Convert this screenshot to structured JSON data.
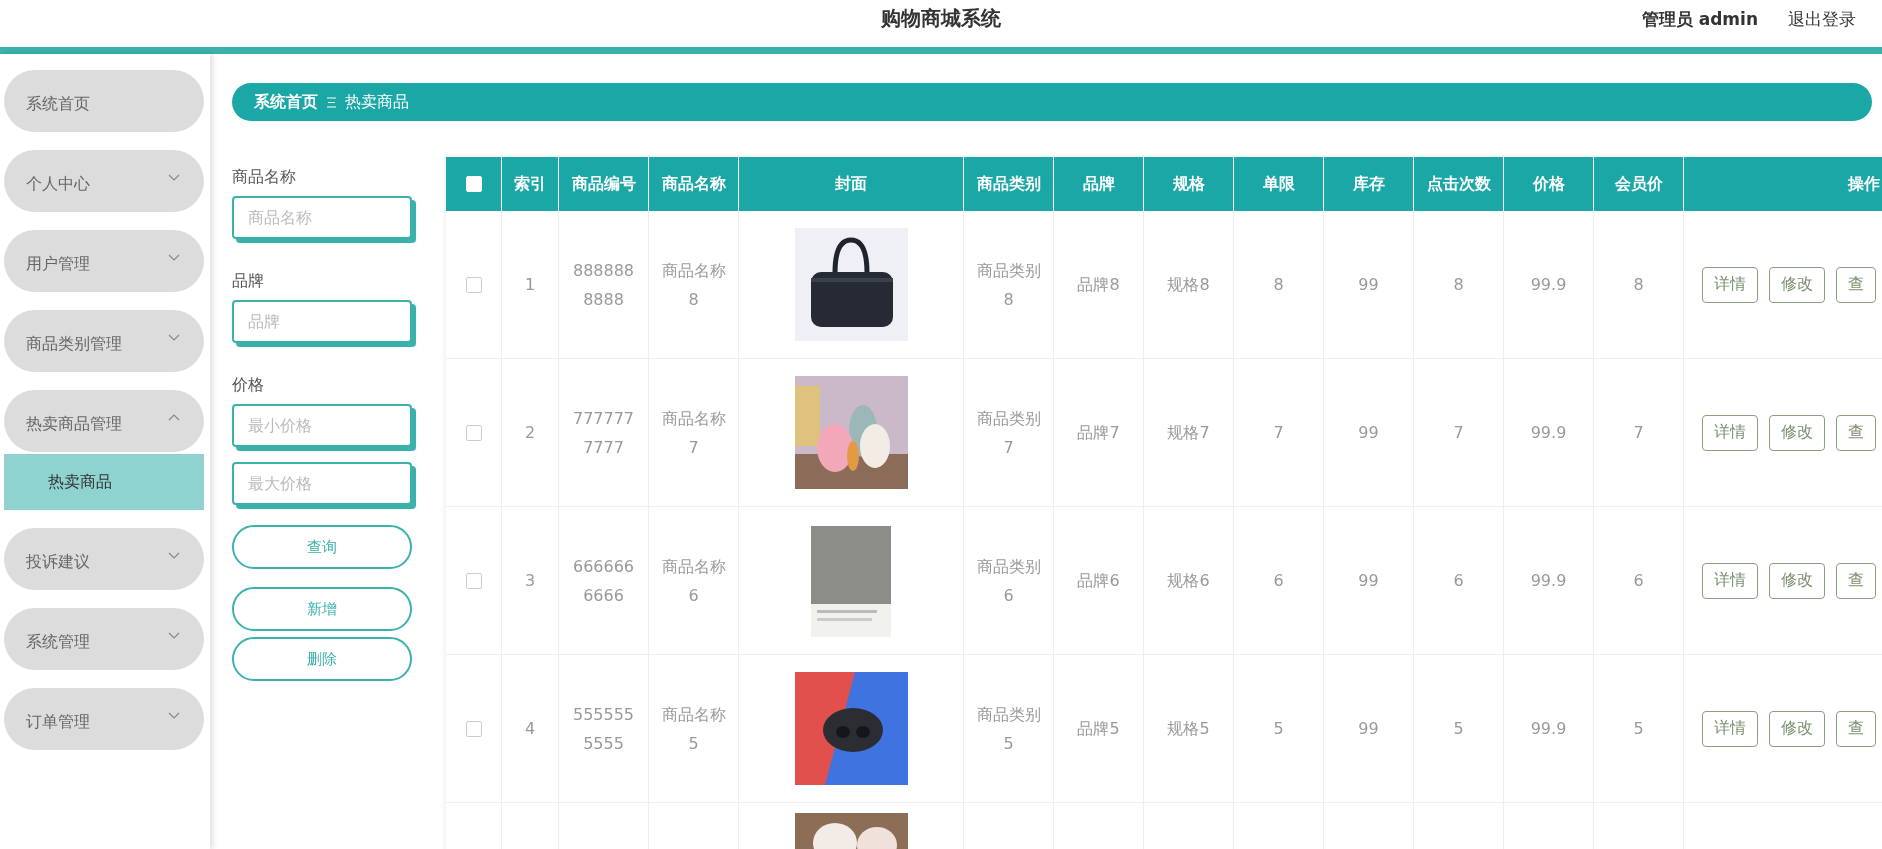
{
  "header": {
    "title": "购物商城系统",
    "user": "管理员 admin",
    "logout": "退出登录"
  },
  "sidebar": {
    "items": [
      {
        "label": "系统首页",
        "expandable": false
      },
      {
        "label": "个人中心",
        "expandable": true,
        "expanded": false
      },
      {
        "label": "用户管理",
        "expandable": true,
        "expanded": false
      },
      {
        "label": "商品类别管理",
        "expandable": true,
        "expanded": false
      },
      {
        "label": "热卖商品管理",
        "expandable": true,
        "expanded": true,
        "children": [
          {
            "label": "热卖商品",
            "selected": true
          }
        ]
      },
      {
        "label": "投诉建议",
        "expandable": true,
        "expanded": false
      },
      {
        "label": "系统管理",
        "expandable": true,
        "expanded": false
      },
      {
        "label": "订单管理",
        "expandable": true,
        "expanded": false
      }
    ]
  },
  "breadcrumb": {
    "home": "系统首页",
    "current": "热卖商品"
  },
  "search": {
    "fields": [
      {
        "label": "商品名称",
        "placeholder": "商品名称"
      },
      {
        "label": "品牌",
        "placeholder": "品牌"
      },
      {
        "label": "价格",
        "placeholder": "最小价格"
      },
      {
        "placeholder": "最大价格"
      }
    ],
    "buttons": [
      "查询",
      "新增",
      "删除"
    ]
  },
  "table": {
    "select_all_checked": false,
    "columns": [
      "索引",
      "商品编号",
      "商品名称",
      "封面",
      "商品类别",
      "品牌",
      "规格",
      "单限",
      "库存",
      "点击次数",
      "价格",
      "会员价",
      "操作"
    ],
    "rows": [
      {
        "checked": false,
        "cells": [
          "1",
          "8888888888",
          "商品名称8",
          null,
          "商品类别8",
          "品牌8",
          "规格8",
          "8",
          "99",
          "8",
          "99.9",
          "8"
        ],
        "actions": [
          "详情",
          "修改",
          "查"
        ]
      },
      {
        "checked": false,
        "cells": [
          "2",
          "7777777777",
          "商品名称7",
          null,
          "商品类别7",
          "品牌7",
          "规格7",
          "7",
          "99",
          "7",
          "99.9",
          "7"
        ],
        "actions": [
          "详情",
          "修改",
          "查"
        ]
      },
      {
        "checked": false,
        "cells": [
          "3",
          "6666666666",
          "商品名称6",
          null,
          "商品类别6",
          "品牌6",
          "规格6",
          "6",
          "99",
          "6",
          "99.9",
          "6"
        ],
        "actions": [
          "详情",
          "修改",
          "查"
        ]
      },
      {
        "checked": false,
        "cells": [
          "4",
          "5555555555",
          "商品名称5",
          null,
          "商品类别5",
          "品牌5",
          "规格5",
          "5",
          "99",
          "5",
          "99.9",
          "5"
        ],
        "actions": [
          "详情",
          "修改",
          "查"
        ]
      },
      {
        "cover": {
          "kind": "picture"
        }
      }
    ]
  }
}
